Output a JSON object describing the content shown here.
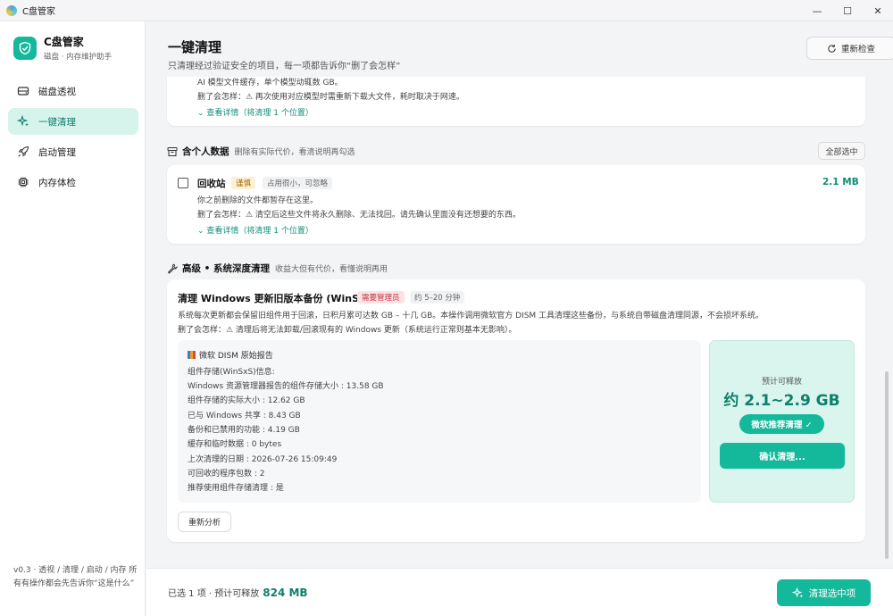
{
  "window": {
    "title": "C盘管家",
    "controls": [
      "—",
      "☐",
      "✕"
    ]
  },
  "sidebar": {
    "brand": {
      "name": "C盘管家",
      "subtitle": "磁盘 · 内存维护助手"
    },
    "items": [
      {
        "label": "磁盘透视",
        "icon": "disk-icon",
        "active": false
      },
      {
        "label": "一键清理",
        "icon": "sparkle-icon",
        "active": true
      },
      {
        "label": "启动管理",
        "icon": "rocket-icon",
        "active": false
      },
      {
        "label": "内存体检",
        "icon": "chip-icon",
        "active": false
      }
    ],
    "footer": "v0.3 · 透视 / 清理 / 启动 / 内存 所有有操作都会先告诉你“这是什么”"
  },
  "header": {
    "title": "一键清理",
    "subtitle": "只清理经过验证安全的项目，每一项都告诉你“删了会怎样”",
    "recheck_label": "重新检查"
  },
  "partial_item": {
    "line1": "AI 模型文件缓存，单个模型动辄数 GB。",
    "line2": "删了会怎样：⚠ 再次使用对应模型时需重新下载大文件，耗时取决于网速。",
    "detail_link": "⌄ 查看详情（将清理 1 个位置）"
  },
  "personal_section": {
    "title": "含个人数据",
    "note": "删除有实际代价，看清说明再勾选",
    "select_all": "全部选中",
    "item": {
      "name": "回收站",
      "tag_caution": "谨慎",
      "tag_note": "占用很小，可忽略",
      "size": "2.1 MB",
      "desc": "你之前删除的文件都暂存在这里。",
      "consequence": "删了会怎样：⚠ 清空后这些文件将永久删除、无法找回。请先确认里面没有还想要的东西。",
      "detail_link": "⌄ 查看详情（将清理 1 个位置）",
      "checked": false
    }
  },
  "advanced_section": {
    "title": "高级 • 系统深度清理",
    "note": "收益大但有代价，看懂说明再用",
    "item": {
      "name": "清理 Windows 更新旧版本备份 (WinSxS)",
      "tag_admin": "需要管理员",
      "tag_time": "约 5–20 分钟",
      "desc": "系统每次更新都会保留旧组件用于回滚，日积月累可达数 GB – 十几 GB。本操作调用微软官方 DISM 工具清理这些备份，与系统自带磁盘清理同源，不会损坏系统。",
      "consequence": "删了会怎样：⚠ 清理后将无法卸载/回滚现有的 Windows 更新（系统运行正常则基本无影响）。",
      "report_title": "微软 DISM 原始报告",
      "report_lines": [
        "组件存储(WinSxS)信息:",
        "Windows 资源管理器报告的组件存储大小 : 13.58 GB",
        "组件存储的实际大小 : 12.62 GB",
        "已与 Windows 共享 : 8.43 GB",
        "备份和已禁用的功能 : 4.19 GB",
        "缓存和临时数据 : 0 bytes",
        "上次清理的日期 : 2026-07-26 15:09:49",
        "可回收的程序包数 : 2",
        "推荐使用组件存储清理 : 是"
      ],
      "release_label": "预计可释放",
      "release_value": "约 2.1~2.9 GB",
      "recommend_label": "微软推荐清理 ✓",
      "confirm_label": "确认清理...",
      "reanalyze_label": "重新分析"
    }
  },
  "bottom": {
    "summary": "已选 1 项 · 预计可释放",
    "amount": "824 MB",
    "clean_label": "清理选中项"
  },
  "colors": {
    "accent": "#14b89a",
    "accent_dark": "#0e7f6a",
    "active_bg": "#d7f4ec",
    "warn_bg": "#fdf0d5",
    "danger_bg": "#fde2e4"
  }
}
